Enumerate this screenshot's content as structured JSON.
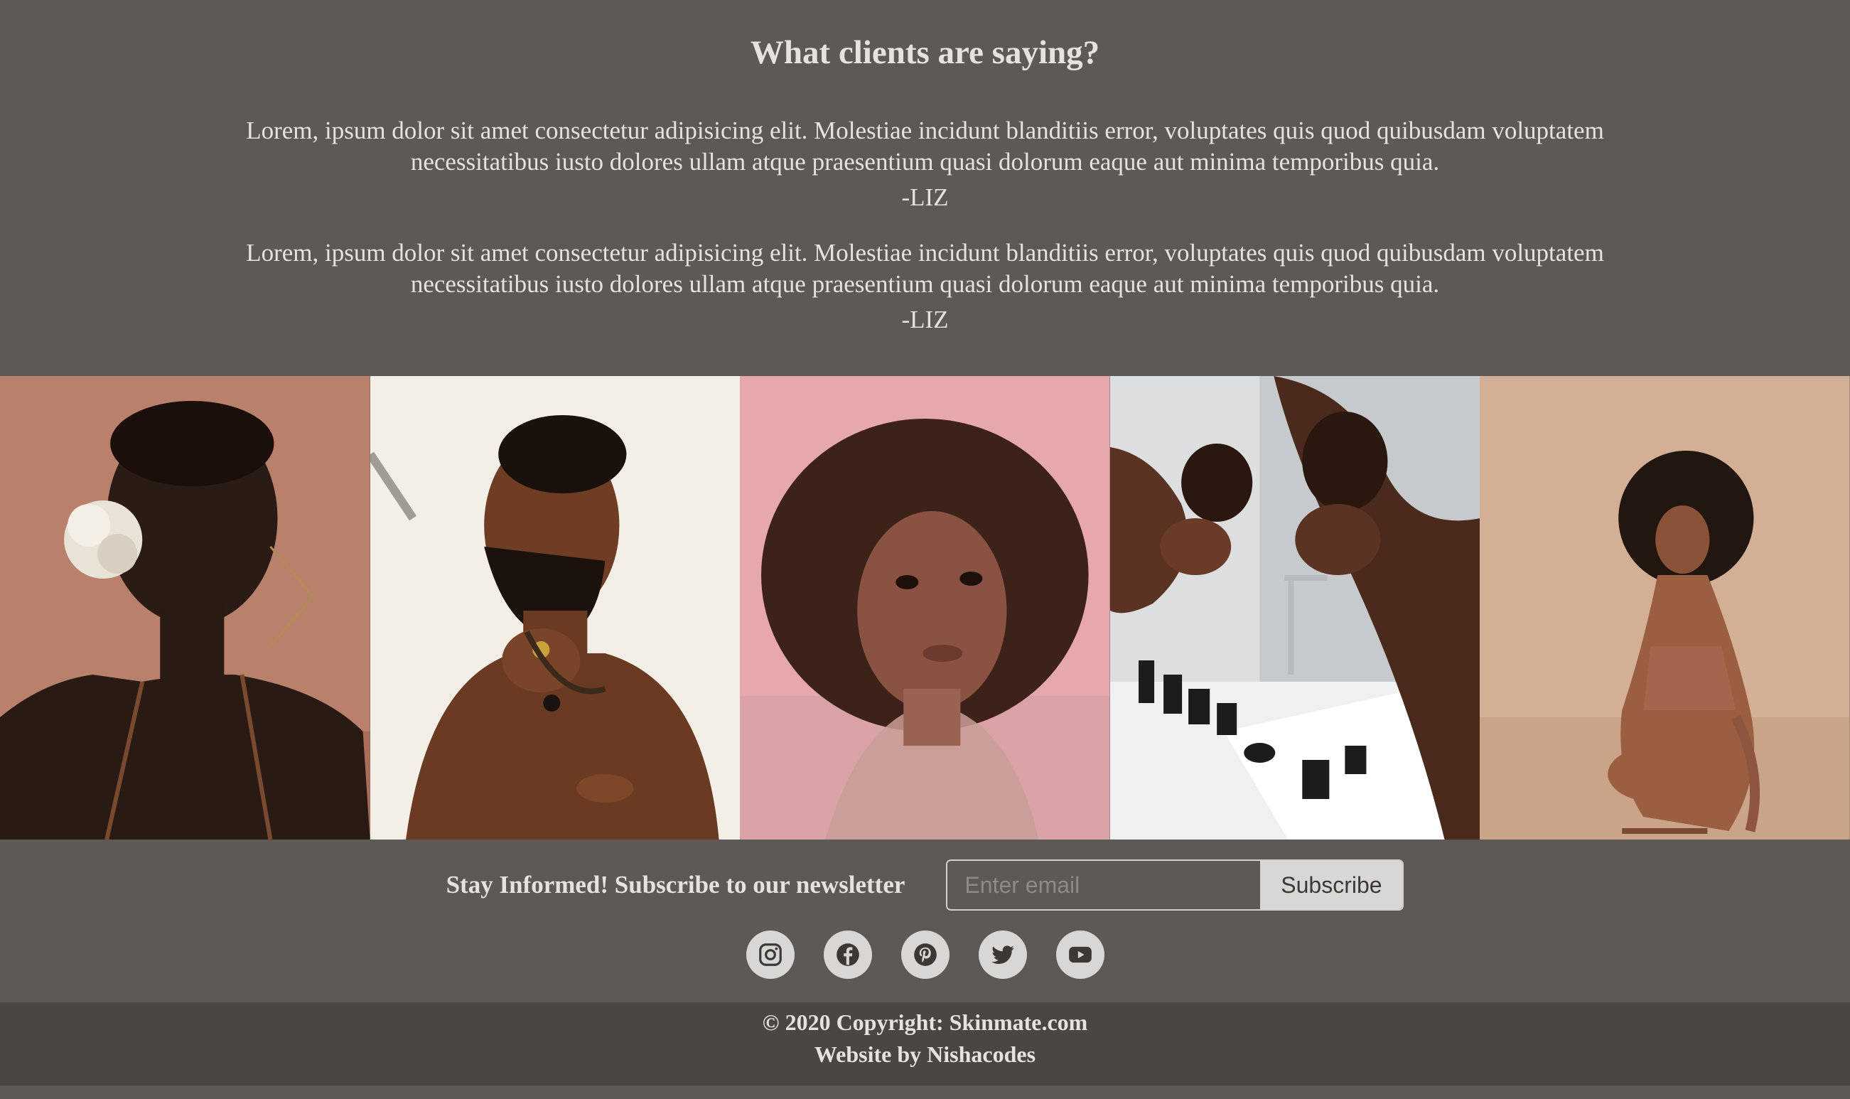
{
  "testimonials": {
    "heading": "What clients are saying?",
    "items": [
      {
        "text": "Lorem, ipsum dolor sit amet consectetur adipisicing elit. Molestiae incidunt blanditiis error, voluptates quis quod quibusdam voluptatem necessitatibus iusto dolores ullam atque praesentium quasi dolorum eaque aut minima temporibus quia.",
        "author": "-LIZ"
      },
      {
        "text": "Lorem, ipsum dolor sit amet consectetur adipisicing elit. Molestiae incidunt blanditiis error, voluptates quis quod quibusdam voluptatem necessitatibus iusto dolores ullam atque praesentium quasi dolorum eaque aut minima temporibus quia.",
        "author": "-LIZ"
      }
    ]
  },
  "gallery": {
    "photos": [
      {
        "name": "portrait-woman-flower"
      },
      {
        "name": "portrait-man-beard"
      },
      {
        "name": "portrait-woman-curly-hair"
      },
      {
        "name": "man-washing-face"
      },
      {
        "name": "woman-crouching"
      }
    ]
  },
  "newsletter": {
    "label": "Stay Informed! Subscribe to our newsletter",
    "email_placeholder": "Enter email",
    "button_label": "Subscribe"
  },
  "socials": [
    {
      "icon": "instagram-icon"
    },
    {
      "icon": "facebook-icon"
    },
    {
      "icon": "pinterest-icon"
    },
    {
      "icon": "twitter-icon"
    },
    {
      "icon": "youtube-icon"
    }
  ],
  "footer": {
    "copyright": "© 2020 Copyright: Skinmate.com",
    "credit": "Website by Nishacodes"
  },
  "colors": {
    "background": "#5d5957",
    "footer_background": "#4a4644",
    "text": "#e8e2df",
    "button": "#d9d7d6"
  }
}
